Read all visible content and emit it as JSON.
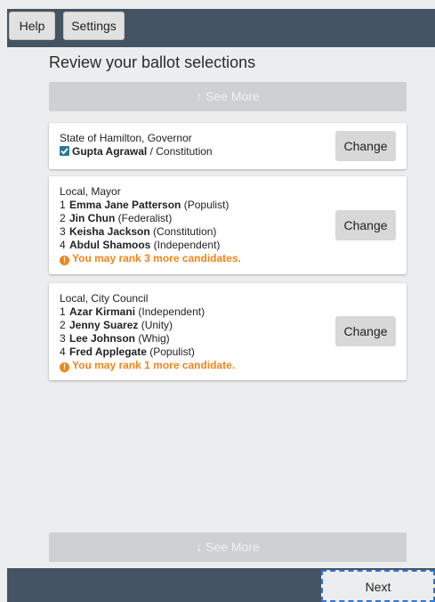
{
  "header": {
    "help_label": "Help",
    "settings_label": "Settings"
  },
  "page": {
    "title": "Review your ballot selections"
  },
  "see_more": {
    "top_label": "↑ See More",
    "bottom_label": "↓ See More"
  },
  "contests": {
    "governor": {
      "title": "State of Hamilton, Governor",
      "selection": {
        "name": "Gupta Agrawal",
        "party": " / Constitution"
      },
      "change_label": "Change"
    },
    "mayor": {
      "title": "Local, Mayor",
      "rankings": [
        {
          "rank": "1",
          "name": "Emma Jane Patterson",
          "party": " (Populist)"
        },
        {
          "rank": "2",
          "name": "Jin Chun",
          "party": " (Federalist)"
        },
        {
          "rank": "3",
          "name": "Keisha Jackson",
          "party": " (Constitution)"
        },
        {
          "rank": "4",
          "name": "Abdul Shamoos",
          "party": " (Independent)"
        }
      ],
      "warning": "You may rank 3 more candidates.",
      "change_label": "Change"
    },
    "council": {
      "title": "Local, City Council",
      "rankings": [
        {
          "rank": "1",
          "name": "Azar Kirmani",
          "party": " (Independent)"
        },
        {
          "rank": "2",
          "name": "Jenny Suarez",
          "party": " (Unity)"
        },
        {
          "rank": "3",
          "name": "Lee Johnson",
          "party": " (Whig)"
        },
        {
          "rank": "4",
          "name": "Fred Applegate",
          "party": " (Populist)"
        }
      ],
      "warning": "You may rank 1 more candidate.",
      "change_label": "Change"
    }
  },
  "footer": {
    "next_label": "Next"
  },
  "colors": {
    "bar": "#455462",
    "warning": "#f0861a",
    "checkbox": "#2a7a97"
  },
  "icons": {
    "warning": "exclamation-circle-icon",
    "check": "checkbox-checked-icon"
  }
}
